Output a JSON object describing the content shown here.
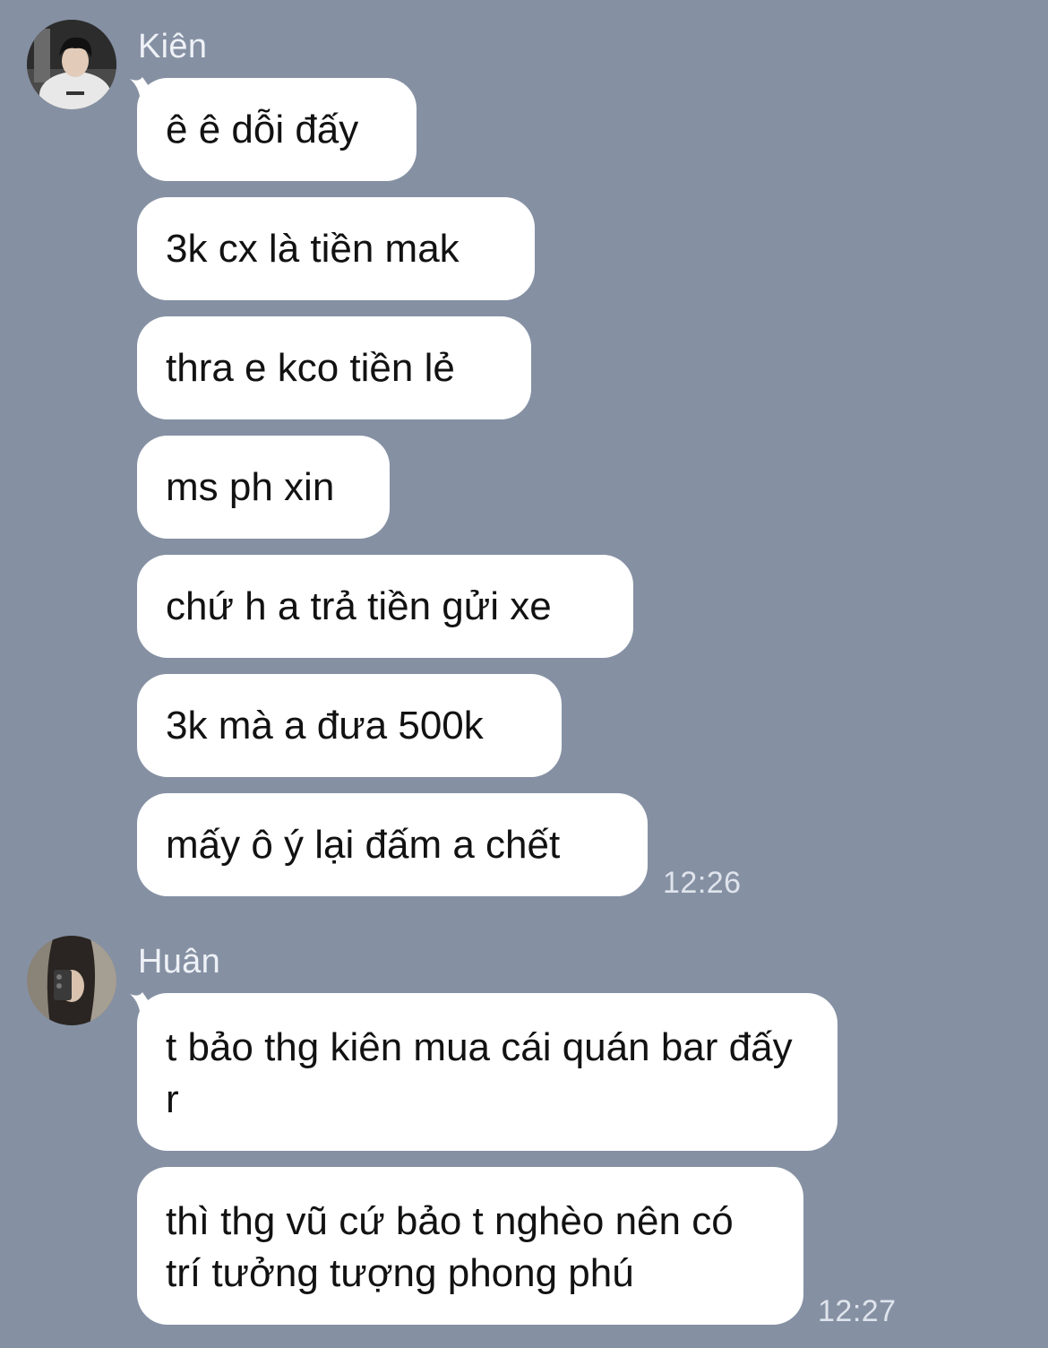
{
  "groups": [
    {
      "sender": "Kiên",
      "messages": [
        "ê ê dỗi đấy",
        "3k cx là tiền mak",
        "thra e kco tiền lẻ",
        "ms ph xin",
        "chứ h a trả tiền gửi xe",
        "3k mà a đưa 500k",
        "mấy ô ý lại đấm a chết"
      ],
      "time": "12:26"
    },
    {
      "sender": "Huân",
      "messages": [
        "t bảo thg kiên mua cái quán bar đấy r",
        "thì thg vũ cứ bảo t nghèo nên có trí tưởng tượng phong phú"
      ],
      "time": "12:27"
    }
  ],
  "colors": {
    "background": "#8590a3",
    "bubble": "#ffffff",
    "text": "#121212",
    "name": "#eef1f6",
    "timestamp": "#dfe4ec"
  }
}
